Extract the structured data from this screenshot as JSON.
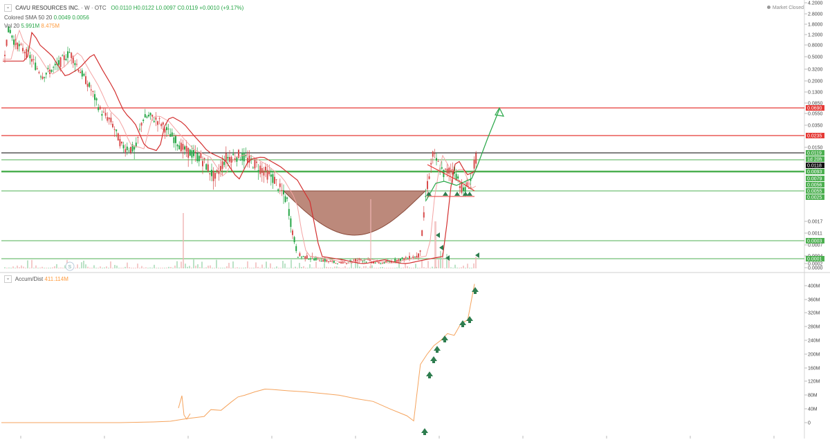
{
  "header": {
    "symbol": "CAVU RESOURCES INC.",
    "interval": "W",
    "exchange": "OTC",
    "o": "O0.0110",
    "h": "H0.0122",
    "l": "L0.0097",
    "c": "C0.0119",
    "change": "+0.0010 (+9.17%)",
    "sma_label": "Colored SMA 50 20",
    "sma_v1": "0.0049",
    "sma_v2": "0.0056",
    "vol_label": "Vol 20",
    "vol_v1": "5.991M",
    "vol_v2": "8.475M",
    "market_status": "Market Closed",
    "ad_label": "Accum/Dist",
    "ad_value": "411.114M",
    "chev": "⌄"
  },
  "colors": {
    "up": "#26a646",
    "down": "#d84c4c",
    "support": "#4caf50",
    "resistance": "#e53935",
    "cup_fill": "#a5624f",
    "ad_line": "#f5a35c",
    "arrow": "#2e7d4f",
    "sma_red": "#d32f2f",
    "sma_pink": "#f4a3a3"
  },
  "chart_data": [
    {
      "type": "candlestick",
      "scale": "log",
      "price_axis_ticks": [
        "4.2000",
        "2.8000",
        "1.8000",
        "1.2000",
        "0.8000",
        "0.5000",
        "0.3200",
        "0.2000",
        "0.1300",
        "0.0850",
        "0.0550",
        "0.0350",
        "0.0150",
        "0.0017",
        "0.0011",
        "0.0007",
        "0.0004",
        "0.0002",
        "0.0000"
      ],
      "price_tick_values": [
        4.2,
        2.8,
        1.8,
        1.2,
        0.8,
        0.5,
        0.32,
        0.2,
        0.13,
        0.085,
        0.055,
        0.035,
        0.015,
        0.0017,
        0.0011,
        0.0007,
        0.0004,
        0.0002,
        0.0
      ],
      "levels": [
        {
          "label": "0.0690",
          "value": 0.069,
          "kind": "resistance"
        },
        {
          "label": "0.0235",
          "value": 0.0235,
          "kind": "resistance"
        },
        {
          "label": "0.0119",
          "value": 0.0119,
          "kind": "current"
        },
        {
          "label": "1d 20h",
          "value": 0.0105,
          "kind": "countdown"
        },
        {
          "label": "0.0118",
          "value": 0.0118,
          "kind": "sma"
        },
        {
          "label": "0.0093",
          "value": 0.0093,
          "kind": "support"
        },
        {
          "label": "0.0079",
          "value": 0.0079,
          "kind": "support"
        },
        {
          "label": "0.0056",
          "value": 0.0056,
          "kind": "support"
        },
        {
          "label": "0.0055",
          "value": 0.0055,
          "kind": "support"
        },
        {
          "label": "0.0025",
          "value": 0.0025,
          "kind": "support"
        },
        {
          "label": "0.0003",
          "value": 0.0003,
          "kind": "support"
        },
        {
          "label": "0.0001",
          "value": 0.0001,
          "kind": "support"
        }
      ],
      "ohlc": {
        "open": 0.011,
        "high": 0.0122,
        "low": 0.0097,
        "close": 0.0119,
        "change": 0.001,
        "change_pct": 9.17
      },
      "sma": {
        "length_1": 50,
        "length_2": 20,
        "value_1": 0.0049,
        "value_2": 0.0056
      },
      "volume": {
        "length": 20,
        "value": "5.991M",
        "ma": "8.475M"
      },
      "annotations": [
        "cup pattern",
        "descending triangle breakout",
        "target arrow toward 0.0690"
      ]
    },
    {
      "type": "line",
      "title": "Accum/Dist",
      "current": "411.114M",
      "y_axis_ticks": [
        "400M",
        "360M",
        "320M",
        "280M",
        "240M",
        "200M",
        "160M",
        "120M",
        "80M",
        "40M",
        "0"
      ],
      "y_tick_values": [
        400,
        360,
        320,
        280,
        240,
        200,
        160,
        120,
        80,
        40,
        0
      ],
      "y_unit": "M",
      "ylim": [
        -20,
        420
      ],
      "x": [
        0,
        5,
        10,
        15,
        20,
        25,
        30,
        35,
        40,
        45,
        50,
        55,
        60,
        62,
        65,
        68,
        70,
        72,
        75,
        78,
        80,
        85,
        90,
        95,
        100,
        105,
        110,
        115,
        120,
        122,
        124,
        126,
        128,
        130,
        132,
        134,
        136,
        138,
        140
      ],
      "values": [
        0,
        0,
        0,
        0,
        0,
        0,
        0,
        0,
        1,
        2,
        4,
        12,
        18,
        38,
        36,
        60,
        75,
        80,
        90,
        98,
        97,
        93,
        90,
        85,
        80,
        70,
        62,
        40,
        20,
        5,
        170,
        200,
        225,
        240,
        260,
        255,
        290,
        300,
        405
      ]
    }
  ]
}
